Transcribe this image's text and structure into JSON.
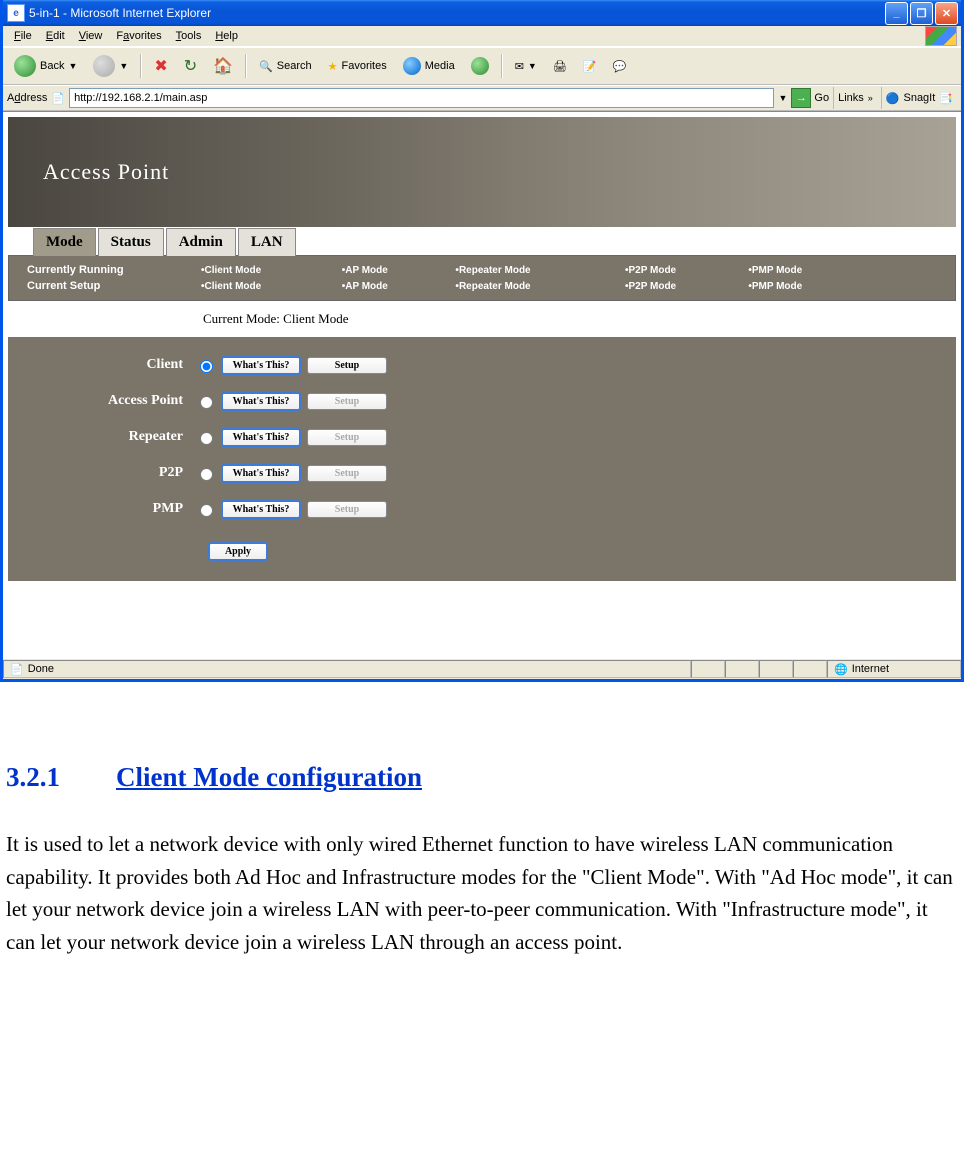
{
  "window": {
    "title": "5-in-1 - Microsoft Internet Explorer"
  },
  "menu": {
    "file": "File",
    "edit": "Edit",
    "view": "View",
    "favorites": "Favorites",
    "tools": "Tools",
    "help": "Help"
  },
  "toolbar": {
    "back": "Back",
    "search": "Search",
    "favorites": "Favorites",
    "media": "Media"
  },
  "address": {
    "label": "Address",
    "value": "http://192.168.2.1/main.asp",
    "go": "Go",
    "links": "Links",
    "snag": "SnagIt"
  },
  "banner": {
    "title": "Access Point"
  },
  "tabs": {
    "mode": "Mode",
    "status": "Status",
    "admin": "Admin",
    "lan": "LAN"
  },
  "bar": {
    "row1": "Currently Running",
    "row2": "Current Setup",
    "c1": "Client Mode",
    "c2": "AP Mode",
    "c3": "Repeater Mode",
    "c4": "P2P Mode",
    "c5": "PMP Mode"
  },
  "current": {
    "label": "Current Mode: Client Mode"
  },
  "modes": {
    "client": "Client",
    "ap": "Access Point",
    "repeater": "Repeater",
    "p2p": "P2P",
    "pmp": "PMP"
  },
  "btn": {
    "what": "What's This?",
    "setup": "Setup",
    "apply": "Apply"
  },
  "status": {
    "done": "Done",
    "zone": "Internet"
  },
  "doc": {
    "num": "3.2.1",
    "title": "Client Mode configuration",
    "body": "It is used to let a network device with only wired Ethernet function to have wireless LAN communication capability. It provides both Ad Hoc and Infrastructure modes for the \"Client Mode\". With \"Ad Hoc mode\", it can let your network device join a wireless LAN with peer-to-peer communication. With \"Infrastructure mode\", it can let your network device join a wireless LAN through an access point."
  }
}
